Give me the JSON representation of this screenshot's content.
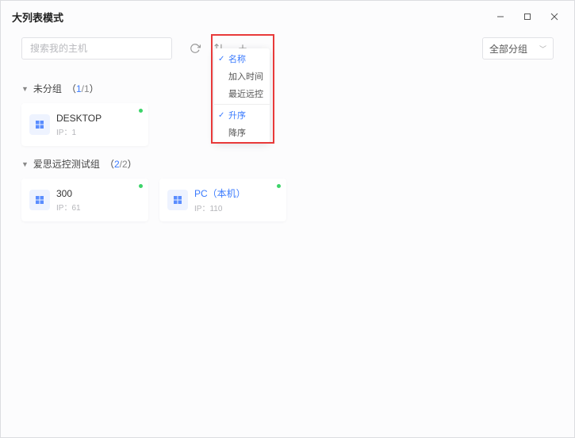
{
  "window": {
    "title": "大列表模式"
  },
  "toolbar": {
    "search_placeholder": "搜索我的主机",
    "group_select_label": "全部分组"
  },
  "sort_menu": {
    "items": [
      {
        "label": "名称",
        "selected": true
      },
      {
        "label": "加入时间",
        "selected": false
      },
      {
        "label": "最近远控",
        "selected": false
      }
    ],
    "order": [
      {
        "label": "升序",
        "selected": true
      },
      {
        "label": "降序",
        "selected": false
      }
    ]
  },
  "groups": {
    "g0": {
      "name": "未分组",
      "count": "1",
      "total": "1",
      "hosts": [
        {
          "name": "DESKTOP",
          "ip": "IP：1",
          "online": true,
          "local": false
        }
      ]
    },
    "g1": {
      "name": "爱思远控测试组",
      "count": "2",
      "total": "2",
      "hosts": [
        {
          "name": "300",
          "ip": "IP：61",
          "online": true,
          "local": false
        },
        {
          "name": "PC（本机）",
          "ip": "IP：110",
          "online": true,
          "local": true
        }
      ]
    }
  }
}
